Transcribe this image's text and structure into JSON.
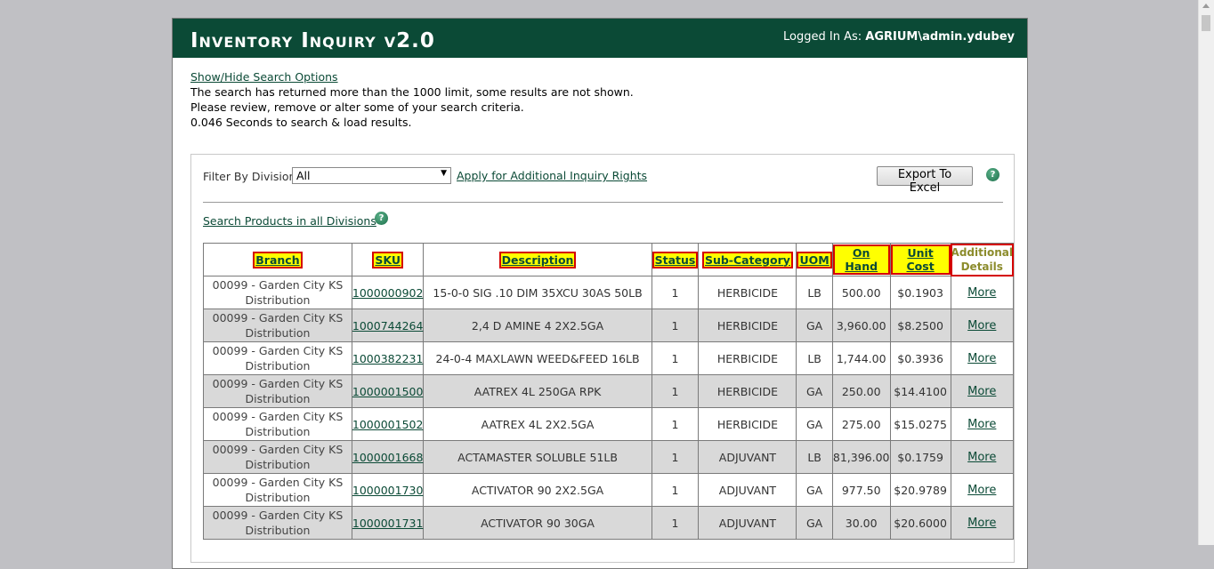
{
  "app": {
    "title": "Inventory Inquiry v2.0",
    "login_label": "Logged In As:",
    "login_user": "AGRIUM\\admin.ydubey"
  },
  "messages": {
    "toggle_link": "Show/Hide Search Options",
    "line1": "The search has returned more than the 1000 limit, some results are not shown.",
    "line2": "Please review, remove or alter some of your search criteria.",
    "line3": "0.046 Seconds to search & load results."
  },
  "filter": {
    "label": "Filter By Division:",
    "selected": "All",
    "apply_link": "Apply for Additional Inquiry Rights",
    "export_button": "Export To Excel",
    "search_all_link": "Search Products in all Divisions",
    "help_icon": "question-circle-icon"
  },
  "table": {
    "headers": [
      "Branch",
      "SKU",
      "Description",
      "Status",
      "Sub-Category",
      "UOM",
      "On Hand",
      "Unit Cost",
      "Additional Details"
    ],
    "rows": [
      {
        "branch": "00099 - Garden City KS Distribution",
        "sku": "1000000902",
        "description": "15-0-0 SIG .10 DIM 35XCU 30AS 50LB",
        "status": "1",
        "subcategory": "HERBICIDE",
        "uom": "LB",
        "onhand": "500.00",
        "unitcost": "$0.1903",
        "more": "More"
      },
      {
        "branch": "00099 - Garden City KS Distribution",
        "sku": "1000744264",
        "description": "2,4 D AMINE 4 2X2.5GA",
        "status": "1",
        "subcategory": "HERBICIDE",
        "uom": "GA",
        "onhand": "3,960.00",
        "unitcost": "$8.2500",
        "more": "More"
      },
      {
        "branch": "00099 - Garden City KS Distribution",
        "sku": "1000382231",
        "description": "24-0-4 MAXLAWN WEED&FEED 16LB",
        "status": "1",
        "subcategory": "HERBICIDE",
        "uom": "LB",
        "onhand": "1,744.00",
        "unitcost": "$0.3936",
        "more": "More"
      },
      {
        "branch": "00099 - Garden City KS Distribution",
        "sku": "1000001500",
        "description": "AATREX 4L 250GA RPK",
        "status": "1",
        "subcategory": "HERBICIDE",
        "uom": "GA",
        "onhand": "250.00",
        "unitcost": "$14.4100",
        "more": "More"
      },
      {
        "branch": "00099 - Garden City KS Distribution",
        "sku": "1000001502",
        "description": "AATREX 4L 2X2.5GA",
        "status": "1",
        "subcategory": "HERBICIDE",
        "uom": "GA",
        "onhand": "275.00",
        "unitcost": "$15.0275",
        "more": "More"
      },
      {
        "branch": "00099 - Garden City KS Distribution",
        "sku": "1000001668",
        "description": "ACTAMASTER SOLUBLE 51LB",
        "status": "1",
        "subcategory": "ADJUVANT",
        "uom": "LB",
        "onhand": "81,396.00",
        "unitcost": "$0.1759",
        "more": "More"
      },
      {
        "branch": "00099 - Garden City KS Distribution",
        "sku": "1000001730",
        "description": "ACTIVATOR 90 2X2.5GA",
        "status": "1",
        "subcategory": "ADJUVANT",
        "uom": "GA",
        "onhand": "977.50",
        "unitcost": "$20.9789",
        "more": "More"
      },
      {
        "branch": "00099 - Garden City KS Distribution",
        "sku": "1000001731",
        "description": "ACTIVATOR 90 30GA",
        "status": "1",
        "subcategory": "ADJUVANT",
        "uom": "GA",
        "onhand": "30.00",
        "unitcost": "$20.6000",
        "more": "More"
      }
    ]
  },
  "colors": {
    "header_bg": "#0b4a36",
    "highlight": "#ffff00",
    "highlight_border": "#d40000",
    "alt_row": "#d9d9d9"
  }
}
